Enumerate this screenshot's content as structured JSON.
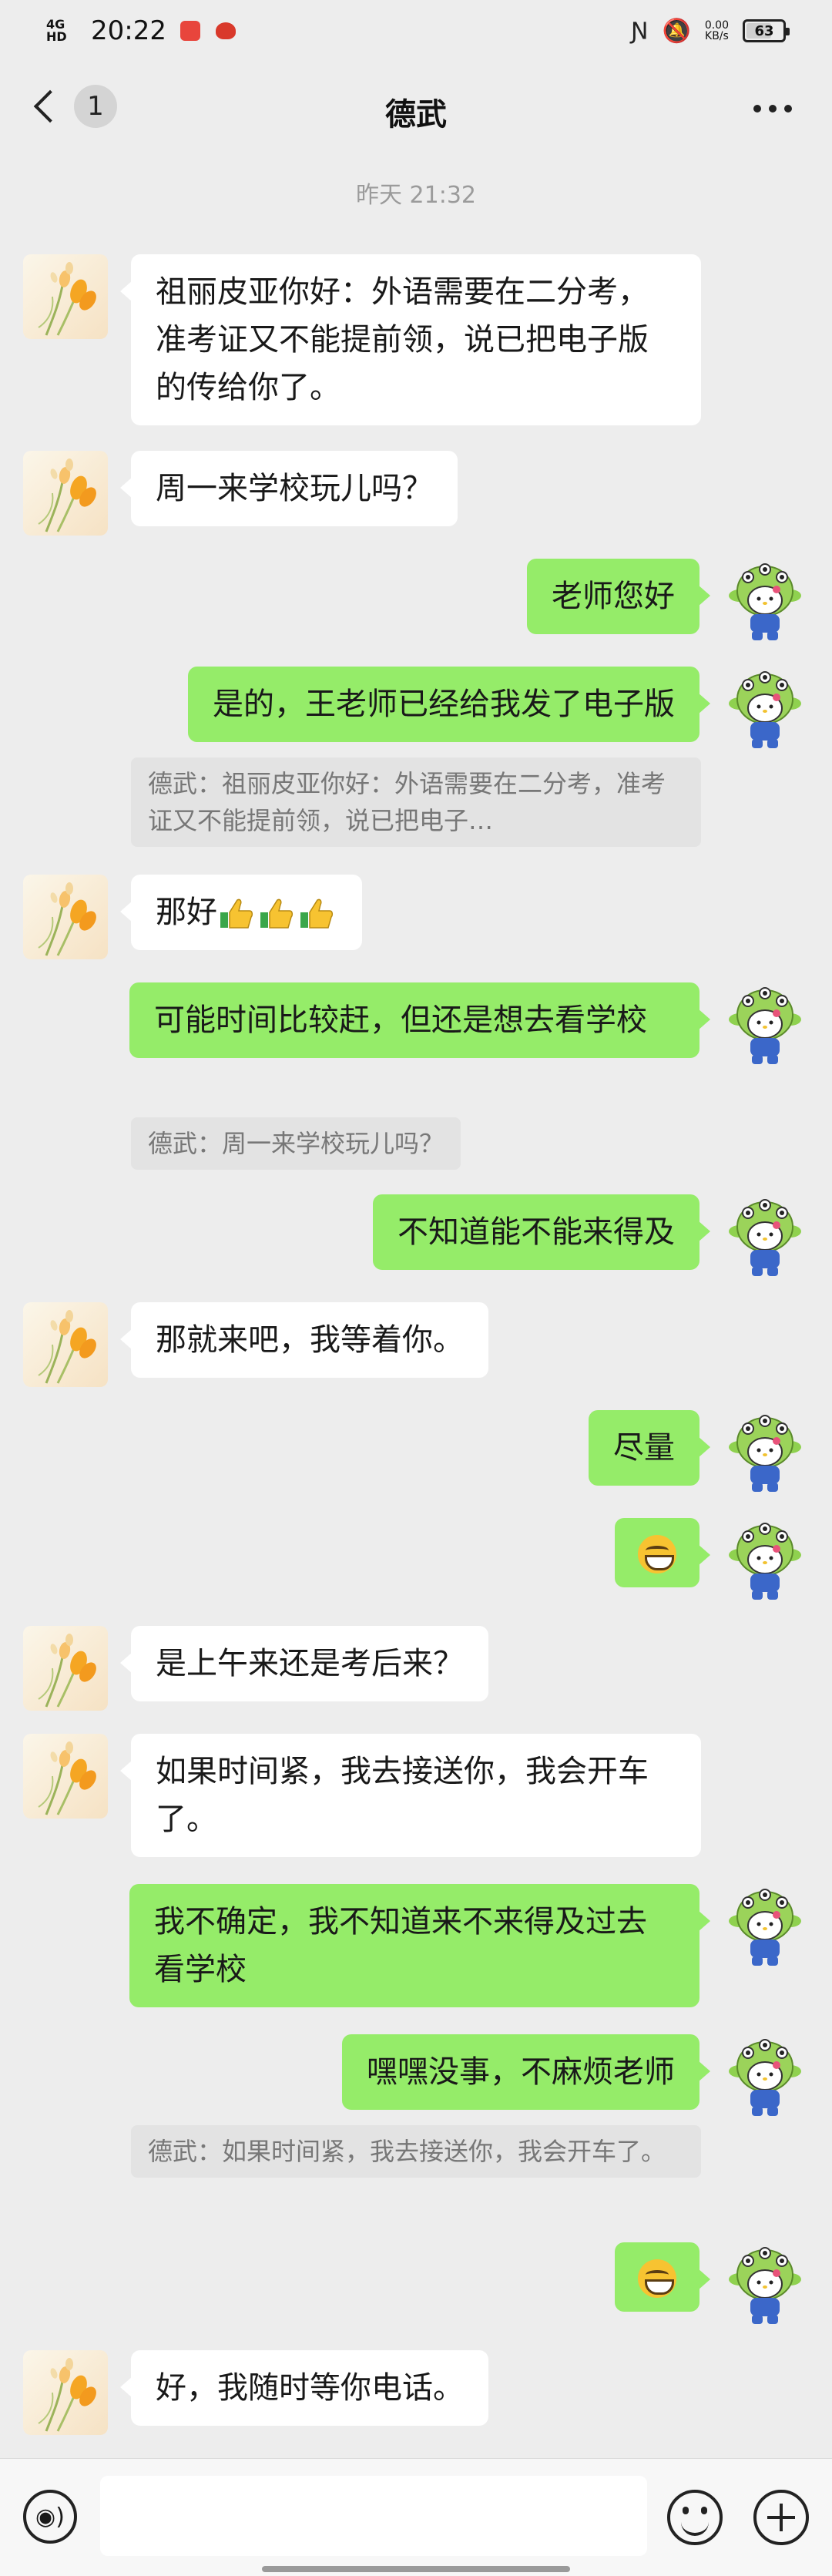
{
  "status_bar": {
    "network": "4G HD",
    "time": "20:22",
    "speed_value": "0.00",
    "speed_unit": "KB/s",
    "battery": "63",
    "battery_level": 0.63
  },
  "nav": {
    "unread_count": "1",
    "title": "德武"
  },
  "timestamp": "昨天 21:32",
  "messages": [
    {
      "from": "them",
      "text": "祖丽皮亚你好：外语需要在二分考，准考证又不能提前领，说已把电子版的传给你了。"
    },
    {
      "from": "them",
      "text": "周一来学校玩儿吗？"
    },
    {
      "from": "me",
      "text": "老师您好"
    },
    {
      "from": "me",
      "text": "是的，王老师已经给我发了电子版",
      "quote": "德武：祖丽皮亚你好：外语需要在二分考，准考证又不能提前领，说已把电子…"
    },
    {
      "from": "them",
      "text": "那好"
    },
    {
      "from": "me",
      "text": "可能时间比较赶，但还是想去看学校",
      "quote": "德武：周一来学校玩儿吗？"
    },
    {
      "from": "me",
      "text": "不知道能不能来得及"
    },
    {
      "from": "them",
      "text": "那就来吧，我等着你。"
    },
    {
      "from": "me",
      "text": "尽量"
    },
    {
      "from": "me",
      "text": ""
    },
    {
      "from": "them",
      "text": "是上午来还是考后来？"
    },
    {
      "from": "them",
      "text": "如果时间紧，我去接送你，我会开车了。"
    },
    {
      "from": "me",
      "text": "我不确定，我不知道来不来得及过去看学校"
    },
    {
      "from": "me",
      "text": "嘿嘿没事，不麻烦老师",
      "quote": "德武：如果时间紧，我去接送你，我会开车了。"
    },
    {
      "from": "me",
      "text": ""
    },
    {
      "from": "them",
      "text": "好，我随时等你电话。"
    }
  ],
  "colors": {
    "background": "#ededed",
    "outgoing_bubble": "#95ec69",
    "incoming_bubble": "#ffffff",
    "quote_bg": "#e3e3e3"
  },
  "icons": [
    "back-chevron-icon",
    "more-icon",
    "voice-icon",
    "emoji-icon",
    "plus-icon",
    "grin-emoji-icon",
    "thumbs-up-icon"
  ]
}
